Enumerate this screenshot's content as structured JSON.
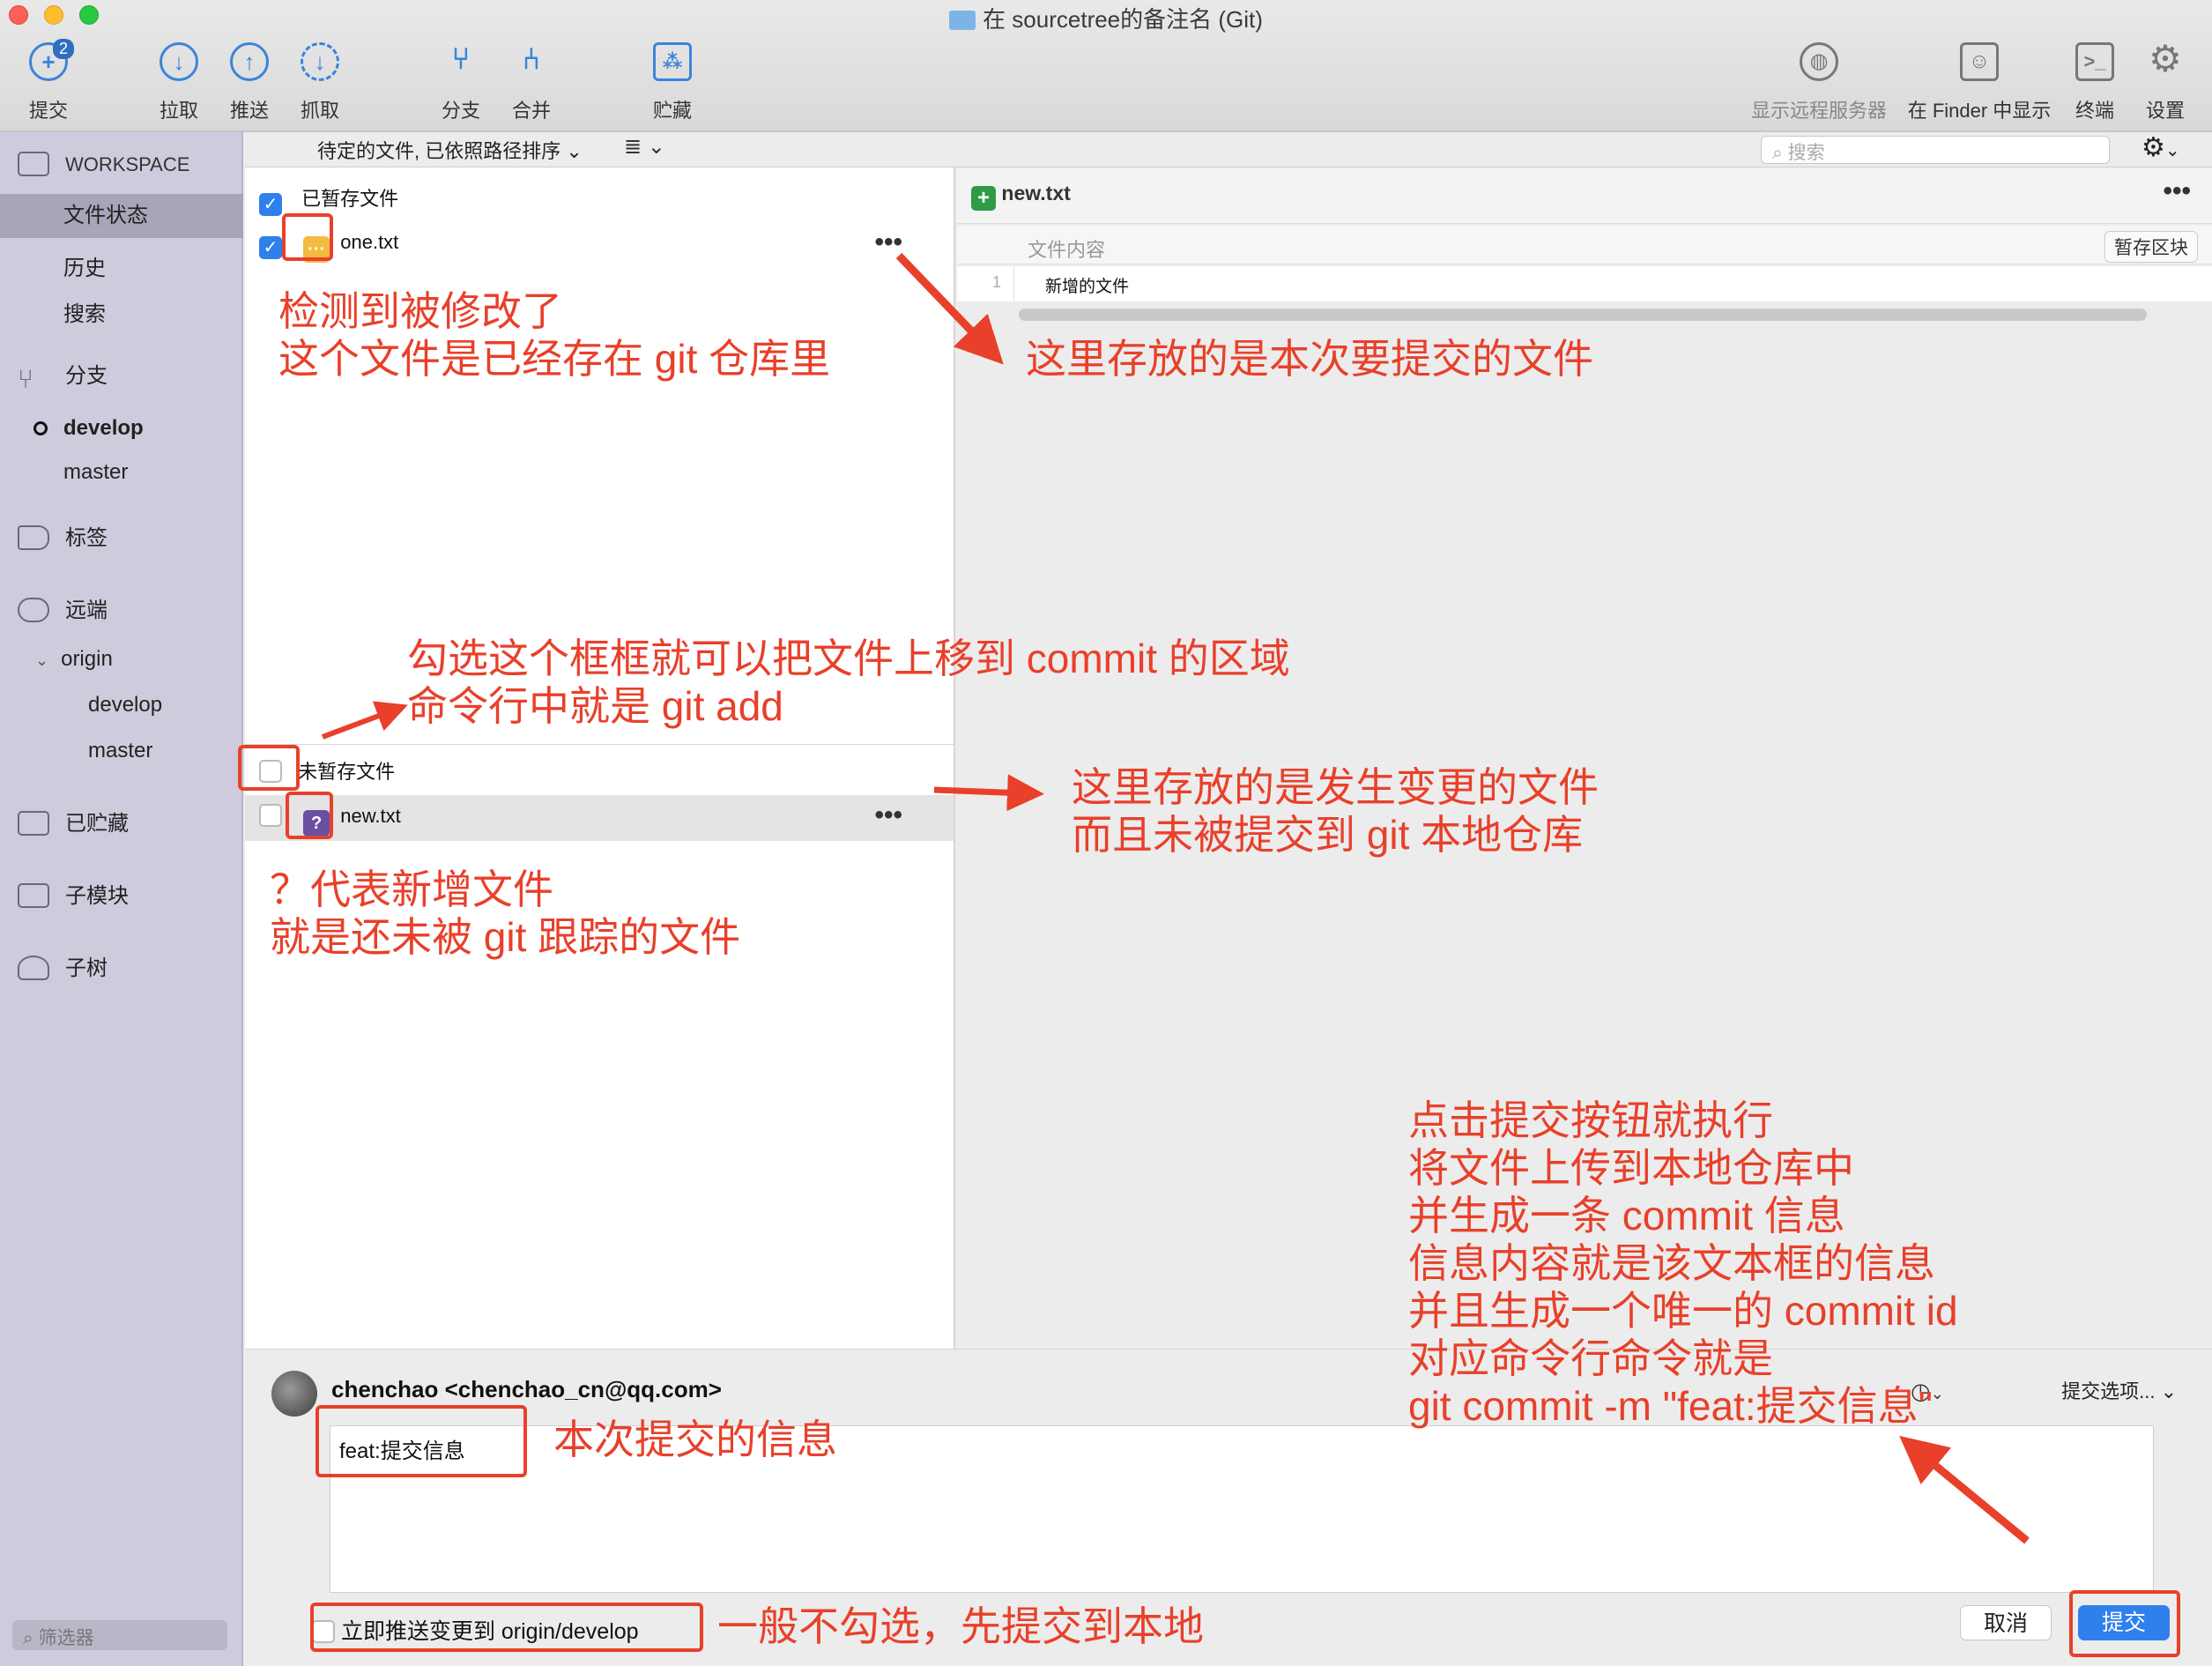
{
  "window": {
    "title": "在 sourcetree的备注名 (Git)"
  },
  "toolbar": {
    "commit": "提交",
    "commit_badge": "2",
    "pull": "拉取",
    "push": "推送",
    "fetch": "抓取",
    "branch": "分支",
    "merge": "合并",
    "stash": "贮藏",
    "remote": "显示远程服务器",
    "finder": "在 Finder 中显示",
    "terminal": "终端",
    "settings": "设置"
  },
  "sidebar": {
    "workspace": "WORKSPACE",
    "file_status": "文件状态",
    "history": "历史",
    "search": "搜索",
    "branches": "分支",
    "develop": "develop",
    "master": "master",
    "tags": "标签",
    "remotes": "远端",
    "origin": "origin",
    "origin_develop": "develop",
    "origin_master": "master",
    "stashes": "已贮藏",
    "submodules": "子模块",
    "subtrees": "子树",
    "filter_placeholder": "筛选器"
  },
  "subheader": {
    "sort": "待定的文件, 已依照路径排序",
    "search_placeholder": "搜索"
  },
  "files": {
    "staged_header": "已暂存文件",
    "staged": [
      {
        "name": "one.txt",
        "status": "modified",
        "icon": "···",
        "color": "#f2bb41"
      }
    ],
    "unstaged_header": "未暂存文件",
    "unstaged": [
      {
        "name": "new.txt",
        "status": "untracked",
        "icon": "?",
        "color": "#6b4fa0"
      }
    ]
  },
  "diff": {
    "filename": "new.txt",
    "hunk_label": "文件内容",
    "stage_hunk": "暂存区块",
    "lines": [
      {
        "num": "1",
        "text": "新增的文件"
      }
    ]
  },
  "commit": {
    "author": "chenchao <chenchao_cn@qq.com>",
    "message": "feat:提交信息",
    "options": "提交选项...",
    "push_option": "立即推送变更到 origin/develop",
    "cancel": "取消",
    "submit": "提交"
  },
  "annotations": {
    "modified_1": "检测到被修改了",
    "modified_2": "这个文件是已经存在 git 仓库里",
    "staged_area": "这里存放的是本次要提交的文件",
    "checkbox_1": "勾选这个框框就可以把文件上移到 commit 的区域",
    "checkbox_2": "命令行中就是 git add",
    "unstaged_1": "这里存放的是发生变更的文件",
    "unstaged_2": "而且未被提交到 git 本地仓库",
    "new_1": "？代表新增文件",
    "new_2": "就是还未被 git 跟踪的文件",
    "commit_1": "点击提交按钮就执行",
    "commit_2": "将文件上传到本地仓库中",
    "commit_3": "并生成一条 commit 信息",
    "commit_4": "信息内容就是该文本框的信息",
    "commit_5": "并且生成一个唯一的 commit id",
    "commit_6": "对应命令行命令就是",
    "commit_7": "git commit -m \"feat:提交信息\"",
    "message_note": "本次提交的信息",
    "push_note": "一般不勾选，先提交到本地"
  },
  "colors": {
    "accent": "#2f80ed",
    "annotation": "#e8402a",
    "sidebar": "#cfcbdc",
    "added": "#2e9b45"
  }
}
